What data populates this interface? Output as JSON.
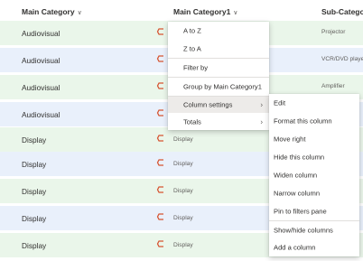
{
  "header": {
    "col1": "Main Category",
    "col2": "Main Category1",
    "col3": "Sub-Category"
  },
  "rows": [
    {
      "main": "Audiovisual",
      "sub": "",
      "subcat": "Projector"
    },
    {
      "main": "Audiovisual",
      "sub": "",
      "subcat": "VCR/DVD player"
    },
    {
      "main": "Audiovisual",
      "sub": "",
      "subcat": "Amplifier"
    },
    {
      "main": "Audiovisual",
      "sub": "",
      "subcat": ""
    },
    {
      "main": "Display",
      "sub": "Display",
      "subcat": ""
    },
    {
      "main": "Display",
      "sub": "Display",
      "subcat": ""
    },
    {
      "main": "Display",
      "sub": "Display",
      "subcat": ""
    },
    {
      "main": "Display",
      "sub": "Display",
      "subcat": ""
    },
    {
      "main": "Display",
      "sub": "Display",
      "subcat": ""
    }
  ],
  "column_menu": {
    "sort_asc": "A to Z",
    "sort_desc": "Z to A",
    "filter_by": "Filter by",
    "group_by": "Group by Main Category1",
    "column_settings": "Column settings",
    "totals": "Totals"
  },
  "column_settings_menu": {
    "edit": "Edit",
    "format": "Format this column",
    "move_right": "Move right",
    "hide": "Hide this column",
    "widen": "Widen column",
    "narrow": "Narrow column",
    "pin": "Pin to filters pane",
    "show_hide": "Show/hide columns",
    "add": "Add a column"
  },
  "colors": {
    "row_green": "#eaf6ea",
    "row_blue": "#e9f0fb",
    "flag_orange": "#d65532"
  }
}
